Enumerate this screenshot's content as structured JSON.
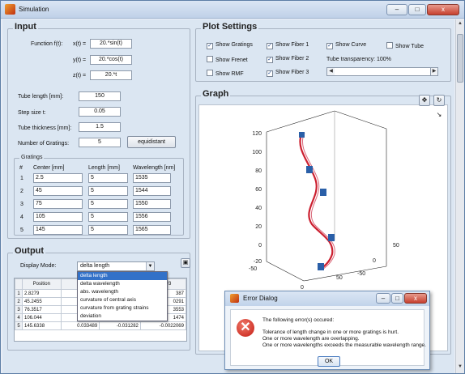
{
  "window": {
    "title": "Simulation",
    "min": "–",
    "max": "□",
    "close": "x"
  },
  "input": {
    "legend": "Input",
    "function_label": "Function f(t):",
    "x_label": "x(t) =",
    "x_value": "20.*sin(t)",
    "y_label": "y(t) =",
    "y_value": "20.*cos(t)",
    "z_label": "z(t) =",
    "z_value": "20.*t",
    "tube_length_label": "Tube length [mm]:",
    "tube_length_value": "150",
    "step_label": "Step size t:",
    "step_value": "0.05",
    "thickness_label": "Tube thickness [mm]:",
    "thickness_value": "1.5",
    "gratings_count_label": "Number of Gratings:",
    "gratings_count_value": "5",
    "equidistant_label": "equidistant"
  },
  "gratings": {
    "legend": "Gratings",
    "headers": [
      "#",
      "Center [mm]",
      "Length [mm]",
      "Wavelength [nm]"
    ],
    "rows": [
      {
        "n": "1",
        "center": "2.5",
        "length": "5",
        "wl": "1535"
      },
      {
        "n": "2",
        "center": "45",
        "length": "5",
        "wl": "1544"
      },
      {
        "n": "3",
        "center": "75",
        "length": "5",
        "wl": "1550"
      },
      {
        "n": "4",
        "center": "105",
        "length": "5",
        "wl": "1556"
      },
      {
        "n": "5",
        "center": "145",
        "length": "5",
        "wl": "1565"
      }
    ]
  },
  "output": {
    "legend": "Output",
    "display_mode_label": "Display Mode:",
    "display_mode_value": "delta length",
    "options": [
      "delta length",
      "delta wavelength",
      "abs. wavelength",
      "curvature of central axis",
      "curvature from grating strains",
      "deviation"
    ],
    "col_position": "Position",
    "col_last": "aL/L #3",
    "rows": [
      {
        "n": "1",
        "pos": "2.8279",
        "a": "",
        "b": "",
        "c": "387"
      },
      {
        "n": "2",
        "pos": "45.2455",
        "a": "",
        "b": "",
        "c": "0291"
      },
      {
        "n": "3",
        "pos": "76.3517",
        "a": "",
        "b": "",
        "c": "3553"
      },
      {
        "n": "4",
        "pos": "106.044",
        "a": "",
        "b": "",
        "c": "1474"
      },
      {
        "n": "5",
        "pos": "145.6338",
        "a": "0.033489",
        "b": "-0.031282",
        "c": "-0.0022069"
      }
    ]
  },
  "plot_settings": {
    "legend": "Plot Settings",
    "show_gratings": "Show Gratings",
    "show_fiber1": "Show Fiber 1",
    "show_curve": "Show Curve",
    "show_tube": "Show Tube",
    "show_frenet": "Show Frenet",
    "show_fiber2": "Show Fiber 2",
    "show_rmf": "Show RMF",
    "show_fiber3": "Show Fiber 3",
    "transparency_label": "Tube transparency: 100%",
    "transparency": 1.0,
    "check": "✓"
  },
  "graph": {
    "legend": "Graph",
    "z_ticks": [
      "120",
      "100",
      "80",
      "60",
      "40",
      "20",
      "0",
      "-20"
    ],
    "x_ticks": [
      "-50",
      "0",
      "50"
    ],
    "y_ticks": [
      "-50",
      "0",
      "50"
    ]
  },
  "error_dialog": {
    "title": "Error Dialog",
    "line1": "The following error(s) occured:",
    "line2": "Tolerance of length change in one or more gratings is hurt.",
    "line3": "One or more wavelength are overlapping.",
    "line4": "One or more wavelengths exceeds the measurable wavelength range.",
    "ok": "OK",
    "icon": "x-icon"
  },
  "colors": {
    "curve": "#cc2030",
    "grating": "#2a5fa8",
    "accent": "#3271c8"
  }
}
